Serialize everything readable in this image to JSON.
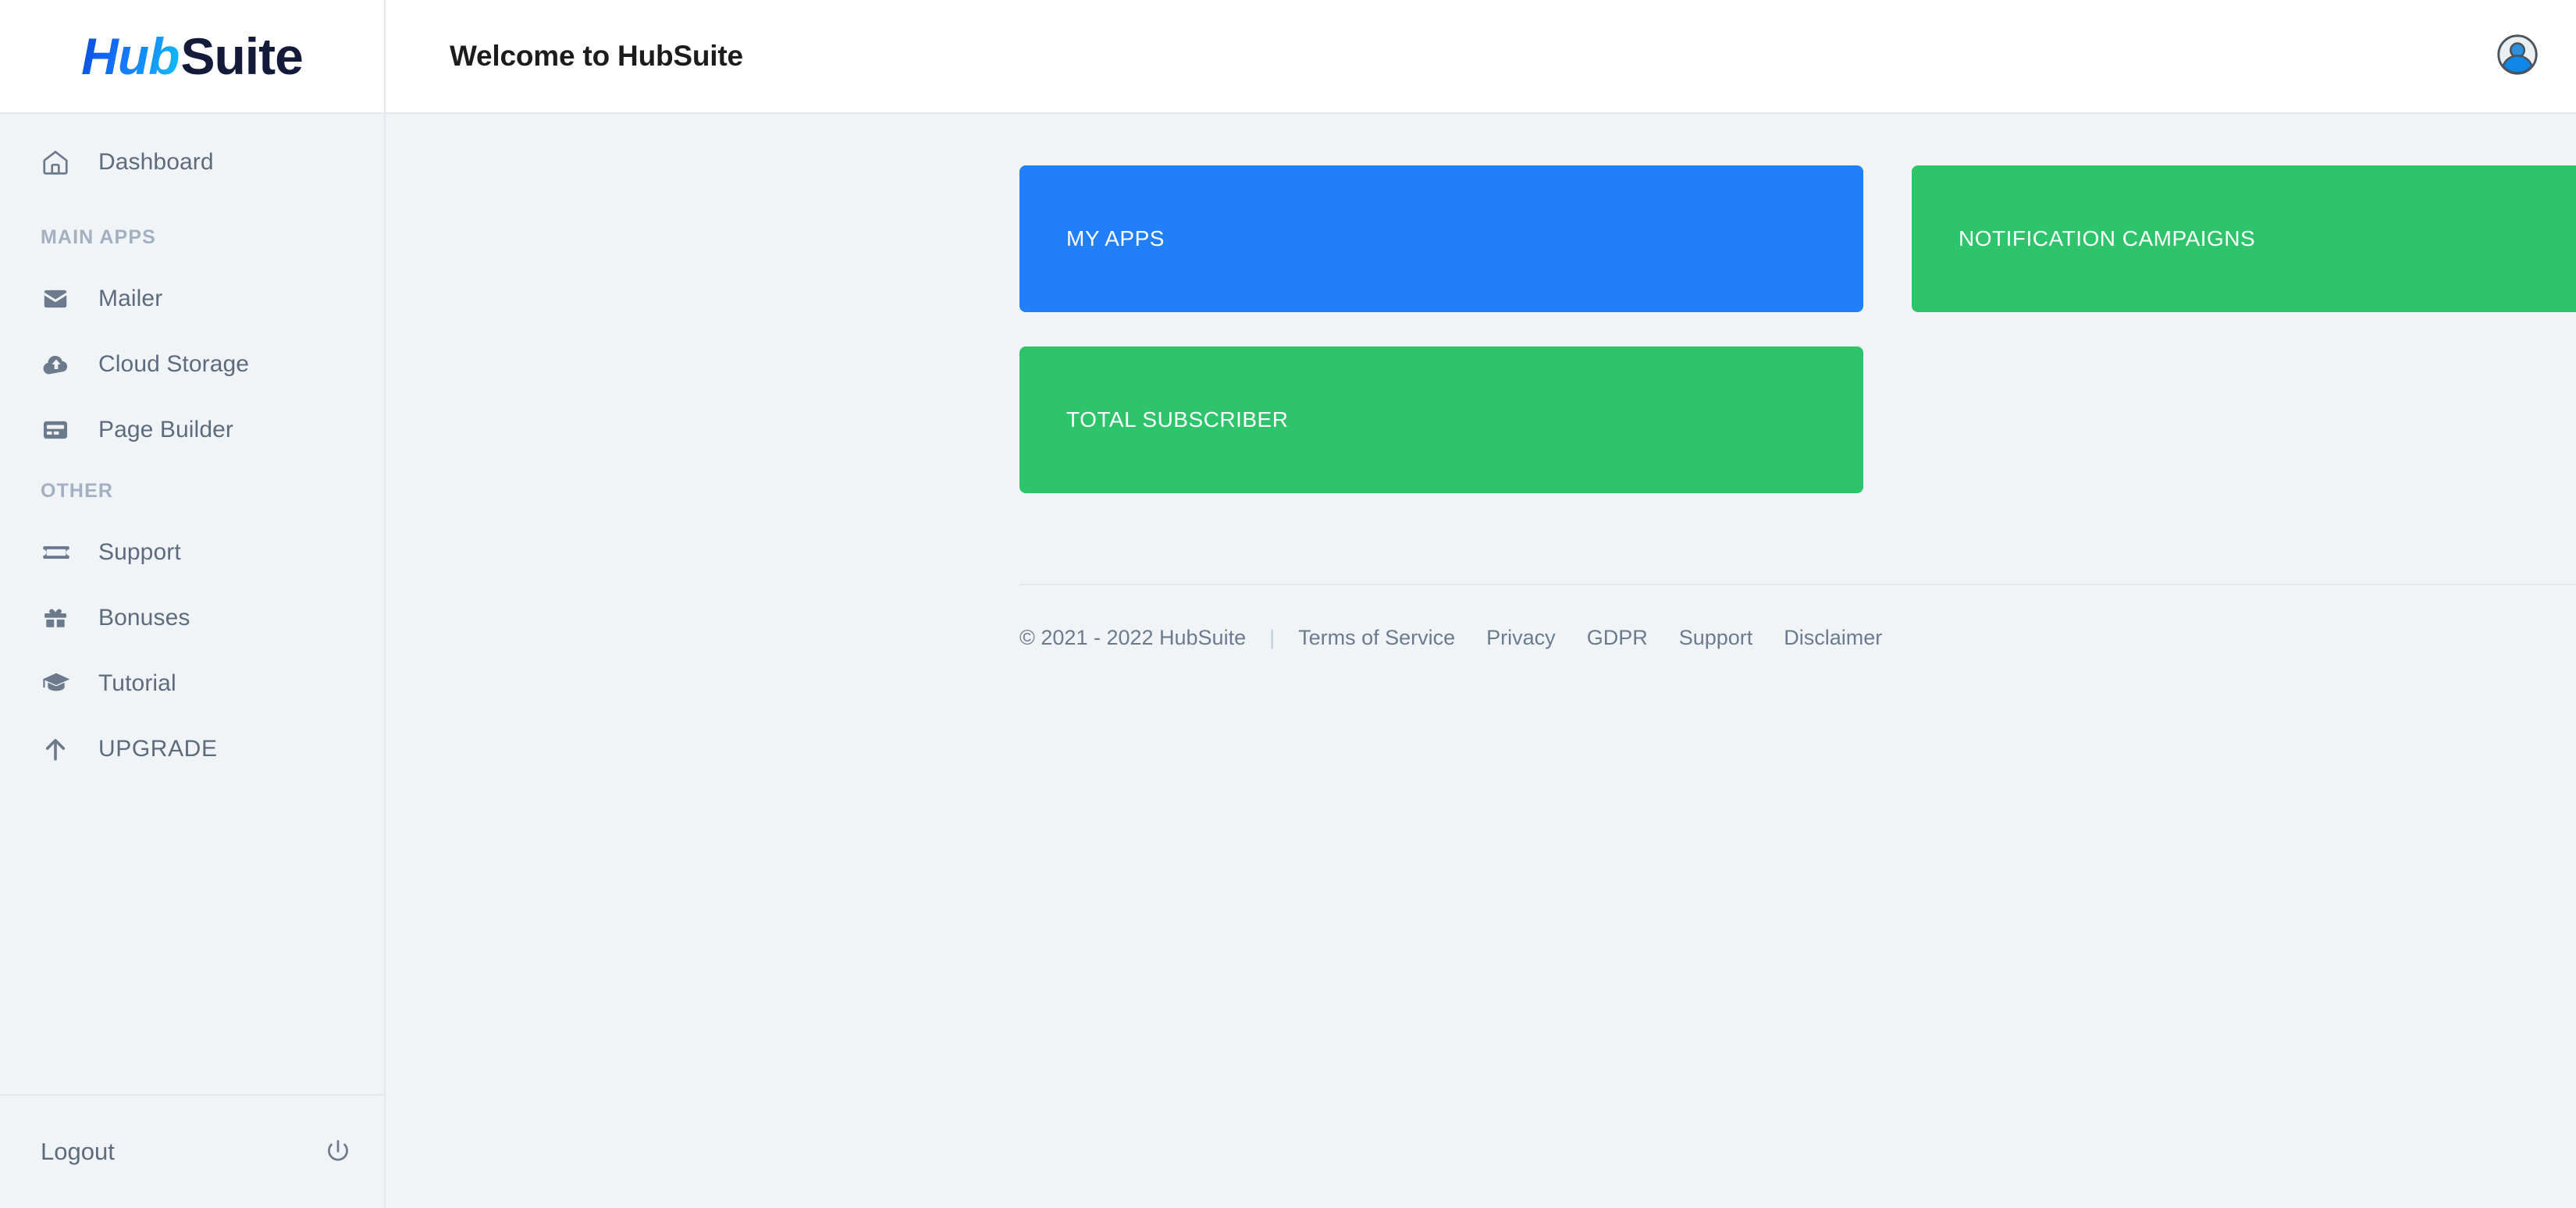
{
  "brand": {
    "logo_part1": "Hub",
    "logo_part2": "Suite",
    "colors": {
      "logo_gradient_start": "#0a47d8",
      "logo_gradient_end": "#11c4f5",
      "logo_dark": "#131a3a",
      "card_blue": "#2180f7",
      "card_green": "#2ec46b",
      "page_bg": "#f1f4f7",
      "sidebar_text": "#5d6b7e",
      "section_label": "#a3b0c2"
    }
  },
  "sidebar": {
    "primary_items": [
      {
        "label": "Dashboard",
        "icon": "home-icon"
      }
    ],
    "sections": [
      {
        "label": "MAIN APPS",
        "items": [
          {
            "label": "Mailer",
            "icon": "envelope-icon"
          },
          {
            "label": "Cloud Storage",
            "icon": "cloud-upload-icon"
          },
          {
            "label": "Page Builder",
            "icon": "page-builder-icon"
          }
        ]
      },
      {
        "label": "OTHER",
        "items": [
          {
            "label": "Support",
            "icon": "ticket-icon"
          },
          {
            "label": "Bonuses",
            "icon": "gift-icon"
          },
          {
            "label": "Tutorial",
            "icon": "graduation-cap-icon"
          },
          {
            "label": "UPGRADE",
            "icon": "arrow-up-icon"
          }
        ]
      }
    ],
    "logout": {
      "label": "Logout",
      "icon": "power-icon"
    }
  },
  "header": {
    "title": "Welcome to HubSuite",
    "avatar_icon": "user-avatar-icon"
  },
  "main": {
    "cards": [
      {
        "title": "MY APPS",
        "color": "blue"
      },
      {
        "title": "NOTIFICATION CAMPAIGNS",
        "color": "green"
      },
      {
        "title": "TOTAL SUBSCRIBER",
        "color": "green"
      }
    ]
  },
  "footer": {
    "copyright": "© 2021 - 2022 HubSuite",
    "separator": "|",
    "links": [
      "Terms of Service",
      "Privacy",
      "GDPR",
      "Support",
      "Disclaimer"
    ]
  }
}
